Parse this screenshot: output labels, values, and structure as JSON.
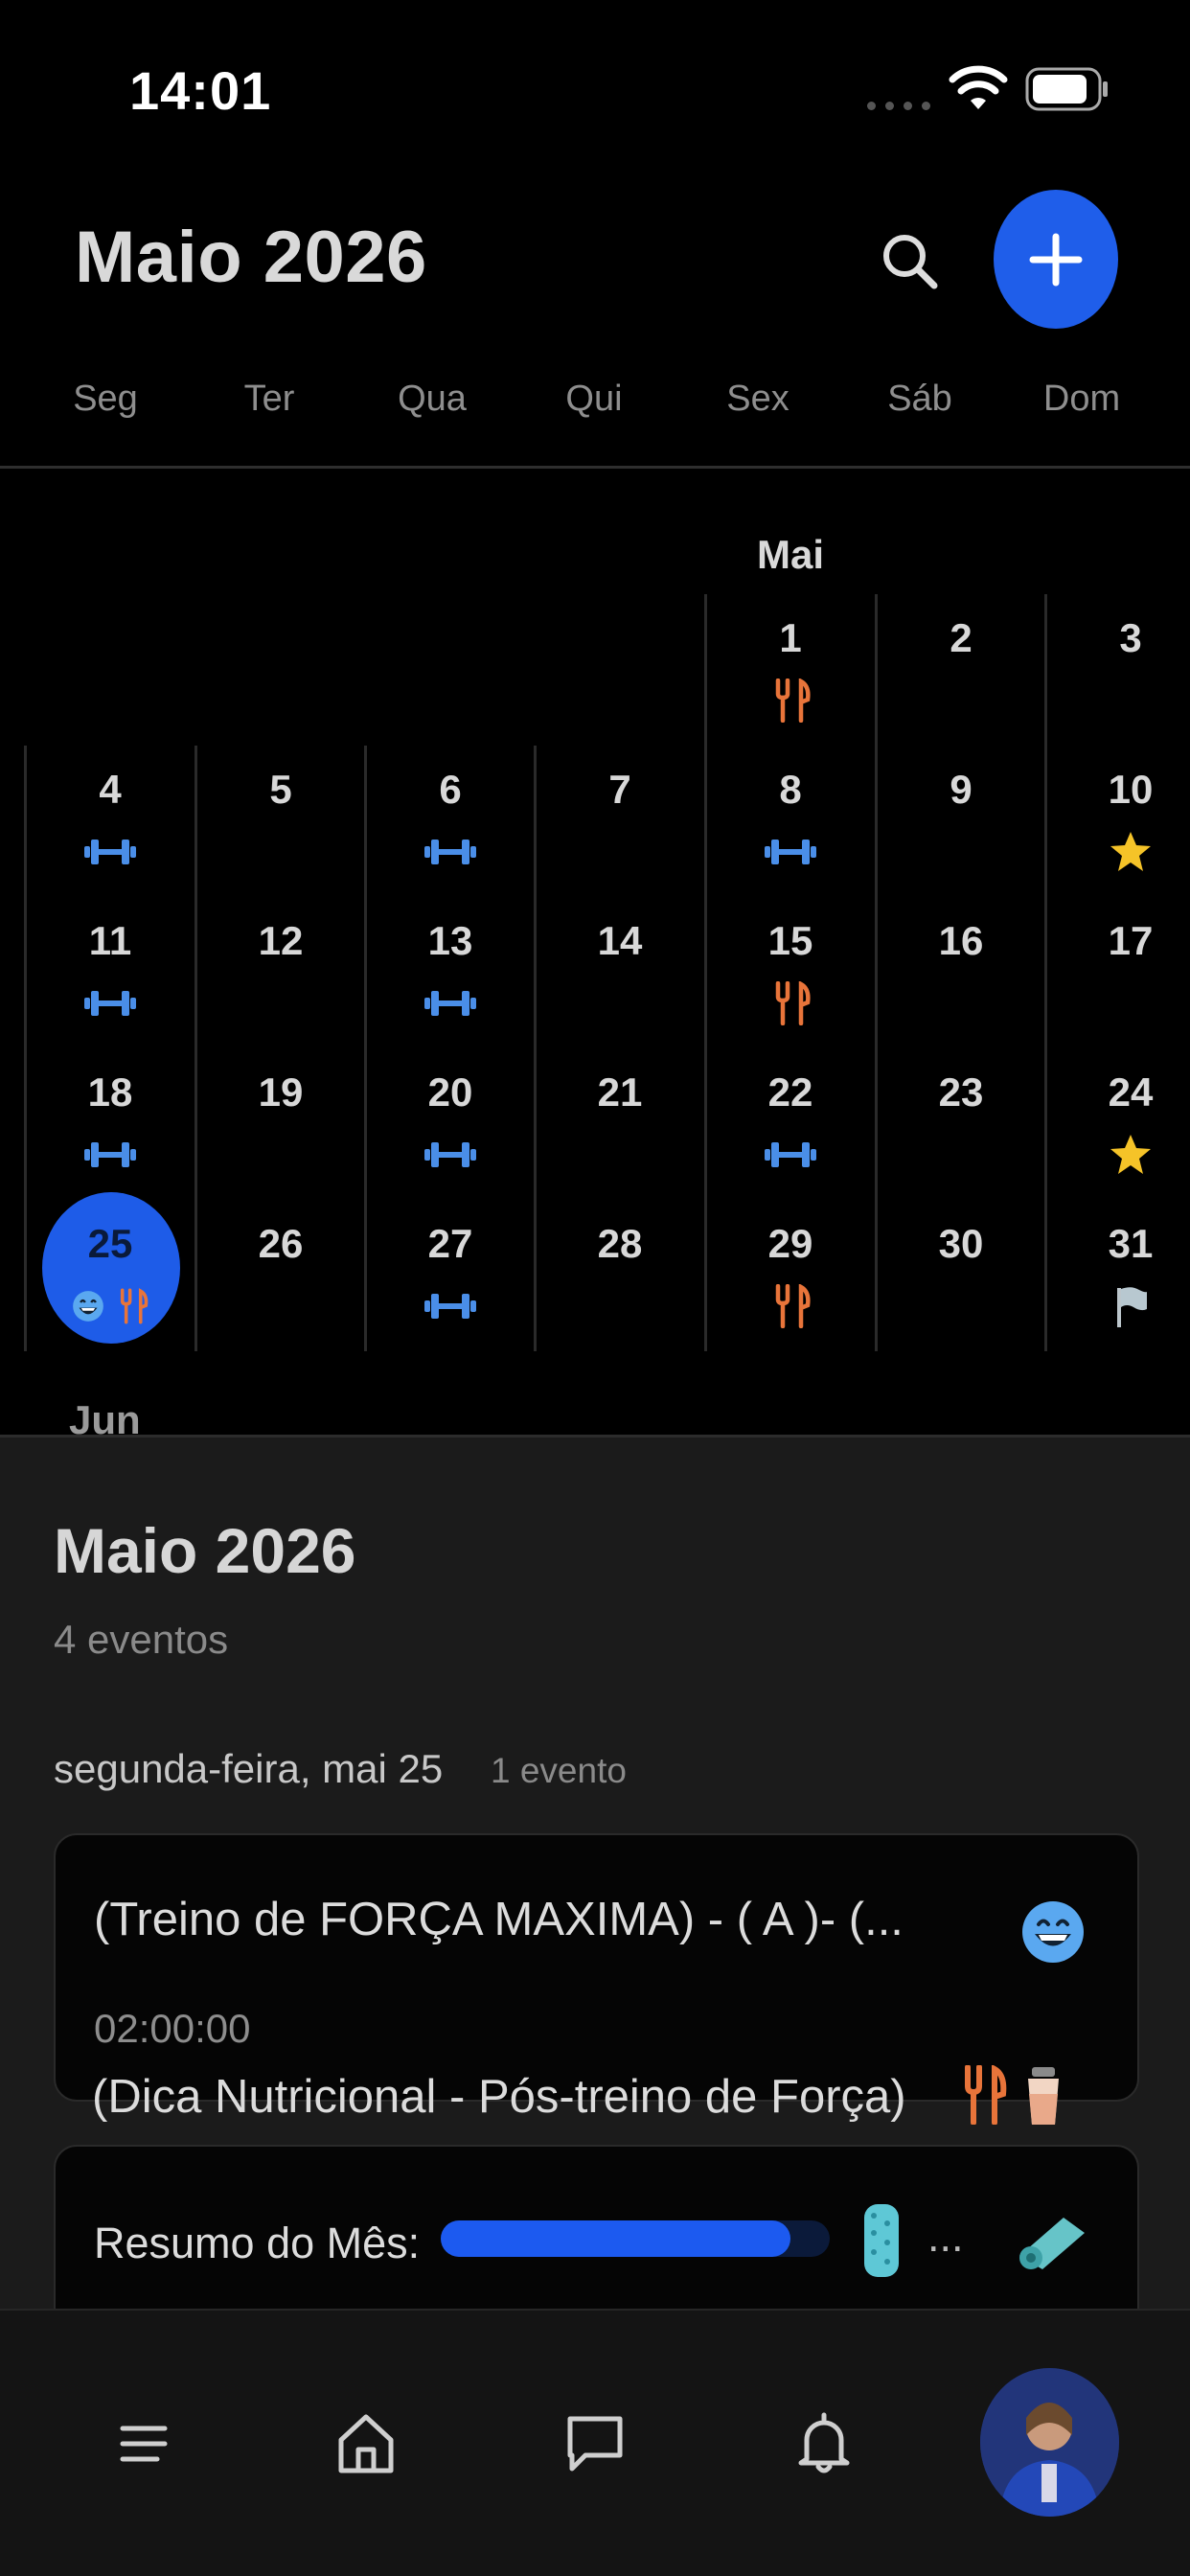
{
  "status_bar": {
    "time": "14:01"
  },
  "header": {
    "title": "Maio 2026",
    "weekdays": [
      "Seg",
      "Ter",
      "Qua",
      "Qui",
      "Sex",
      "Sáb",
      "Dom"
    ]
  },
  "calendar": {
    "month_label": "Mai",
    "next_month_label": "Jun",
    "today": "25",
    "days": [
      {
        "day": "1",
        "icons": [
          "fork-knife"
        ]
      },
      {
        "day": "2",
        "icons": []
      },
      {
        "day": "3",
        "icons": []
      },
      {
        "day": "4",
        "icons": [
          "dumbbell"
        ]
      },
      {
        "day": "5",
        "icons": []
      },
      {
        "day": "6",
        "icons": [
          "dumbbell"
        ]
      },
      {
        "day": "7",
        "icons": []
      },
      {
        "day": "8",
        "icons": [
          "dumbbell"
        ]
      },
      {
        "day": "9",
        "icons": []
      },
      {
        "day": "10",
        "icons": [
          "star"
        ]
      },
      {
        "day": "11",
        "icons": [
          "dumbbell"
        ]
      },
      {
        "day": "12",
        "icons": []
      },
      {
        "day": "13",
        "icons": [
          "dumbbell"
        ]
      },
      {
        "day": "14",
        "icons": []
      },
      {
        "day": "15",
        "icons": [
          "fork-knife"
        ]
      },
      {
        "day": "16",
        "icons": []
      },
      {
        "day": "17",
        "icons": []
      },
      {
        "day": "18",
        "icons": [
          "dumbbell"
        ]
      },
      {
        "day": "19",
        "icons": []
      },
      {
        "day": "20",
        "icons": [
          "dumbbell"
        ]
      },
      {
        "day": "21",
        "icons": []
      },
      {
        "day": "22",
        "icons": [
          "dumbbell"
        ]
      },
      {
        "day": "23",
        "icons": []
      },
      {
        "day": "24",
        "icons": [
          "star"
        ]
      },
      {
        "day": "25",
        "icons": [
          "grin-emoji",
          "fork-knife"
        ]
      },
      {
        "day": "26",
        "icons": []
      },
      {
        "day": "27",
        "icons": [
          "dumbbell"
        ]
      },
      {
        "day": "28",
        "icons": []
      },
      {
        "day": "29",
        "icons": [
          "fork-knife"
        ]
      },
      {
        "day": "30",
        "icons": []
      },
      {
        "day": "31",
        "icons": [
          "flag"
        ]
      }
    ]
  },
  "sheet": {
    "title": "Maio 2026",
    "event_count": "4 eventos",
    "day_heading": "segunda-feira, mai 25",
    "day_event_count": "1 evento",
    "event": {
      "title": "(Treino de FORÇA MAXIMA) - ( A )- (...",
      "duration": "02:00:00",
      "icon": "grin-emoji"
    },
    "tip": {
      "text": "(Dica Nutricional - Pós-treino de Força)",
      "icons": [
        "fork-knife",
        "shaker-cup"
      ]
    },
    "summary": {
      "label": "Resumo do Mês:",
      "progress": 0.9,
      "more": "...",
      "icons": [
        "foam-roller",
        "yoga-mat"
      ]
    }
  },
  "tabbar": {
    "items": [
      "menu",
      "home",
      "chat",
      "notifications",
      "profile"
    ]
  },
  "colors": {
    "accent": "#1f5eea",
    "dumbbell": "#4a8ee8",
    "fork_knife": "#e8743a",
    "star": "#f5c328"
  }
}
